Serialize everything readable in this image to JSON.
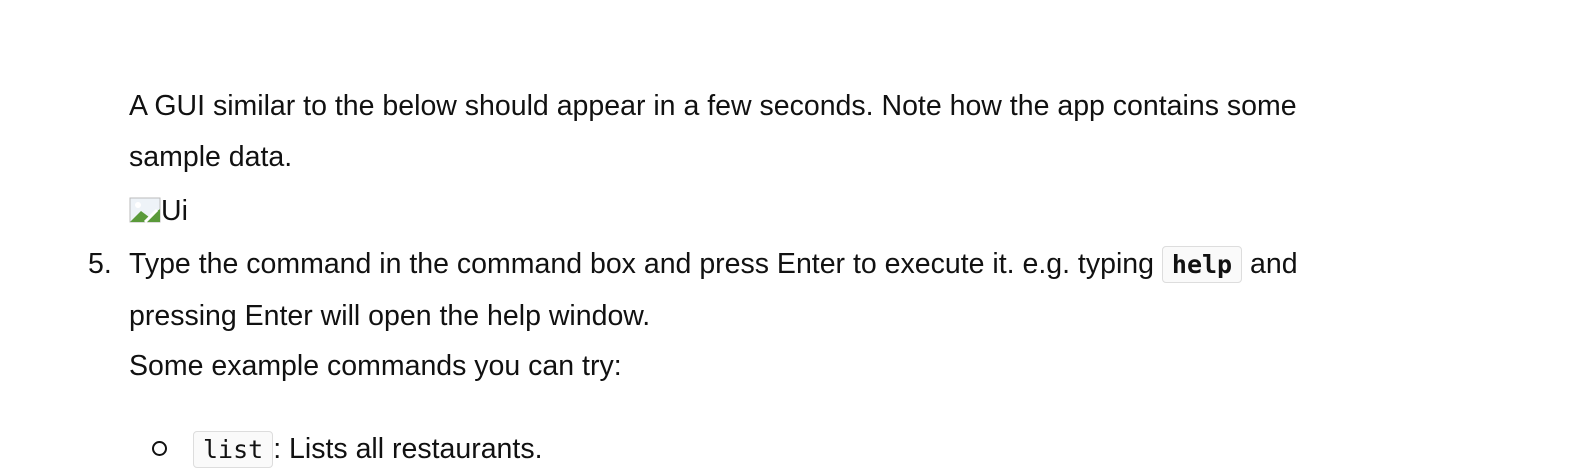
{
  "paragraph_intro": {
    "line1": "A GUI similar to the below should appear in a few seconds. Note how the app contains some",
    "line2": "sample data.",
    "image_alt": "Ui"
  },
  "step5": {
    "number": "5.",
    "text_before": "Type the command in the command box and press Enter to execute it. e.g. typing",
    "code": "help",
    "text_after": "and",
    "line2": "pressing Enter will open the help window.",
    "line3": "Some example commands you can try:"
  },
  "examples": [
    {
      "code": "list",
      "description": ": Lists all restaurants."
    }
  ]
}
